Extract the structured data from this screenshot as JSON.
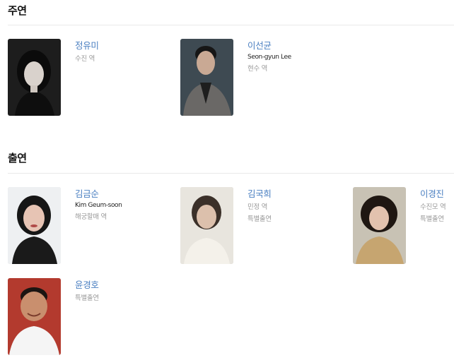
{
  "sections": [
    {
      "title": "주연",
      "cast": [
        {
          "name": "정유미",
          "english_name": "",
          "role": "수진 역"
        },
        {
          "name": "이선균",
          "english_name": "Seon-gyun Lee",
          "role": "현수 역"
        }
      ]
    },
    {
      "title": "출연",
      "cast": [
        {
          "name": "김금순",
          "english_name": "Kim Geum-soon",
          "role": "해궁할매 역"
        },
        {
          "name": "김국희",
          "english_name": "",
          "role": "민정 역",
          "role2": "특별출연"
        },
        {
          "name": "이경진",
          "english_name": "",
          "role": "수진모 역",
          "role2": "특별출연"
        },
        {
          "name": "윤경호",
          "english_name": "",
          "role": "특별출연"
        }
      ]
    }
  ]
}
